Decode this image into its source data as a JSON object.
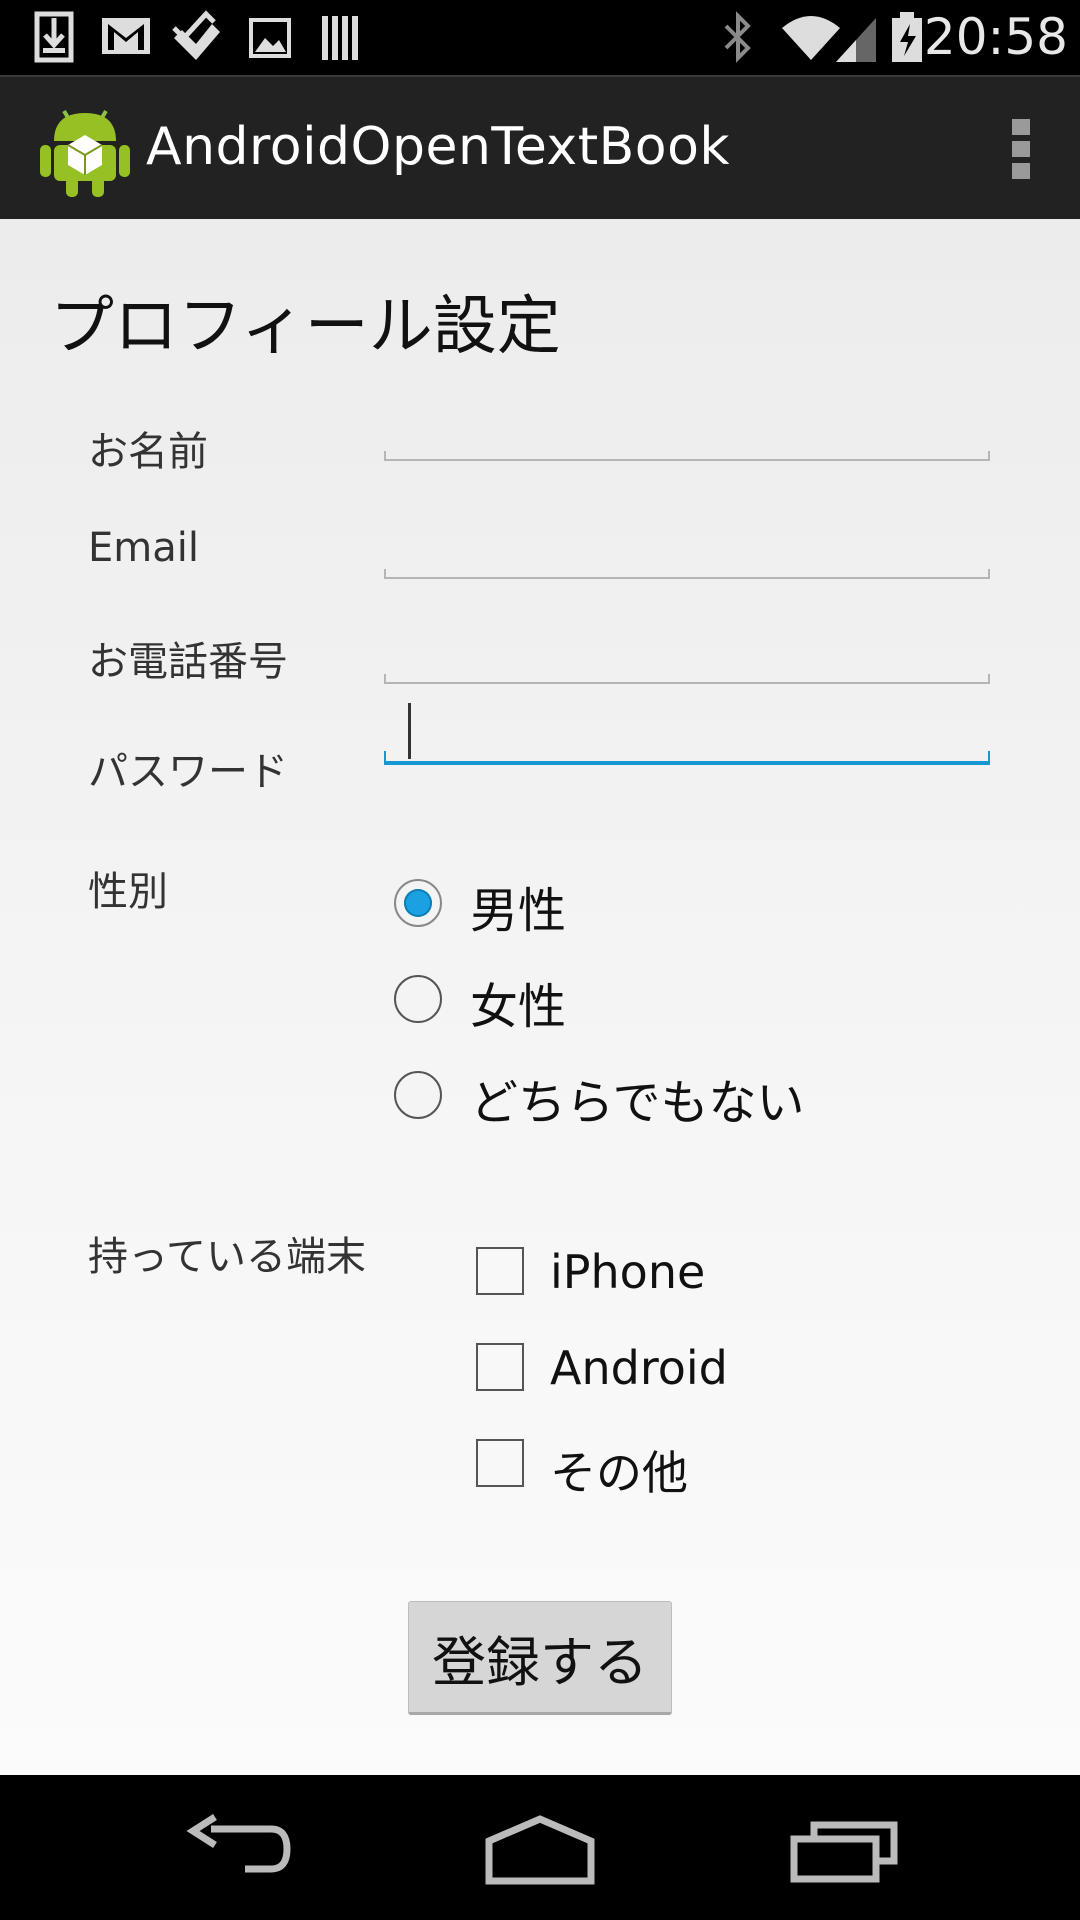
{
  "status_bar": {
    "time": "20:58",
    "left_icons": [
      "download-icon",
      "gmail-icon",
      "check-double-icon",
      "image-icon",
      "barcode-icon"
    ],
    "right_icons": [
      "bluetooth-icon",
      "wifi-icon",
      "signal-icon",
      "battery-charging-icon"
    ]
  },
  "action_bar": {
    "title": "AndroidOpenTextBook",
    "overflow_icon": "more-vert-icon"
  },
  "form": {
    "title": "プロフィール設定",
    "fields": [
      {
        "label": "お名前",
        "value": ""
      },
      {
        "label": "Email",
        "value": ""
      },
      {
        "label": "お電話番号",
        "value": ""
      },
      {
        "label": "パスワード",
        "value": ""
      }
    ],
    "gender": {
      "label": "性別",
      "options": [
        "男性",
        "女性",
        "どちらでもない"
      ],
      "selected": "男性"
    },
    "devices": {
      "label": "持っている端末",
      "options": [
        "iPhone",
        "Android",
        "その他"
      ],
      "checked": []
    },
    "submit_label": "登録する"
  },
  "colors": {
    "accent": "#1ba1e2",
    "action_bar": "#222222"
  },
  "nav_bar": [
    "back-icon",
    "home-icon",
    "recent-apps-icon"
  ]
}
